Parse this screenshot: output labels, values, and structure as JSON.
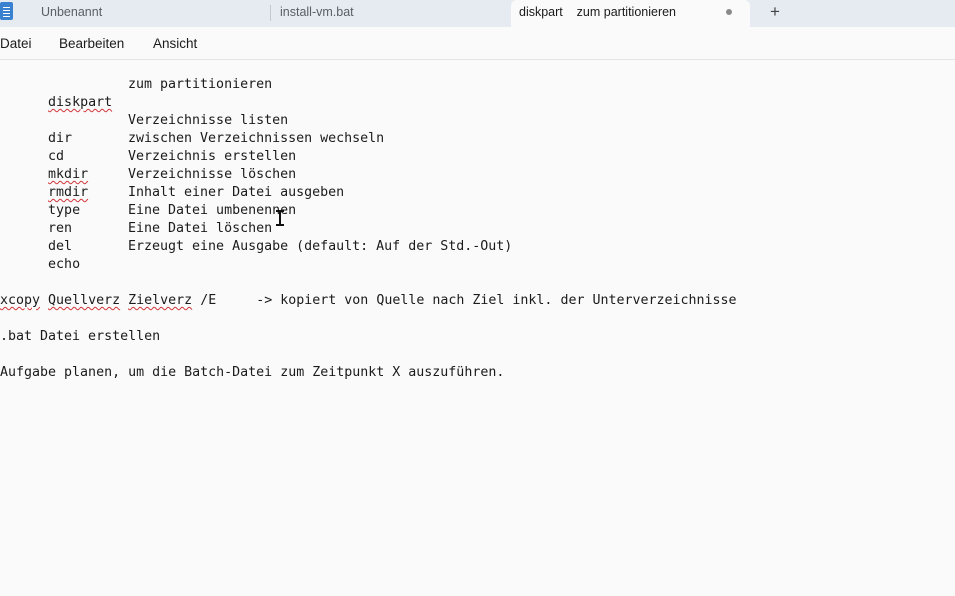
{
  "tabs": [
    {
      "label": "Unbenannt"
    },
    {
      "label": "install-vm.bat"
    },
    {
      "label": "diskpart    zum partitionieren",
      "active": true,
      "unsaved": true
    }
  ],
  "new_tab_symbol": "+",
  "menu": {
    "file": "Datei",
    "edit": "Bearbeiten",
    "view": "Ansicht"
  },
  "editor": {
    "line_header": {
      "cmd": "diskpart",
      "desc": "zum partitionieren"
    },
    "commands": [
      {
        "cmd": "dir",
        "desc": "Verzeichnisse listen"
      },
      {
        "cmd": "cd",
        "desc": "zwischen Verzeichnissen wechseln"
      },
      {
        "cmd": "mkdir",
        "desc": "Verzeichnis erstellen"
      },
      {
        "cmd": "rmdir",
        "desc": "Verzeichnisse löschen"
      },
      {
        "cmd": "type",
        "desc": "Inhalt einer Datei ausgeben"
      },
      {
        "cmd": "ren",
        "desc": "Eine Datei umbenennen"
      },
      {
        "cmd": "del",
        "desc": "Eine Datei löschen"
      },
      {
        "cmd": "echo",
        "desc": "Erzeugt eine Ausgabe (default: Auf der Std.-Out)"
      }
    ],
    "xcopy": {
      "cmd": "xcopy",
      "src": "Quellverz",
      "dst": "Zielverz",
      "flag": "/E",
      "desc": "-> kopiert von Quelle nach Ziel inkl. der Unterverzeichnisse"
    },
    "bat_line": ".bat Datei erstellen",
    "task_line": "Aufgabe planen, um die Batch-Datei zum Zeitpunkt X auszuführen."
  },
  "colors": {
    "spellcheck": "#d13438",
    "tabbar": "#e6ebf2",
    "app_icon": "#3a82cf"
  }
}
